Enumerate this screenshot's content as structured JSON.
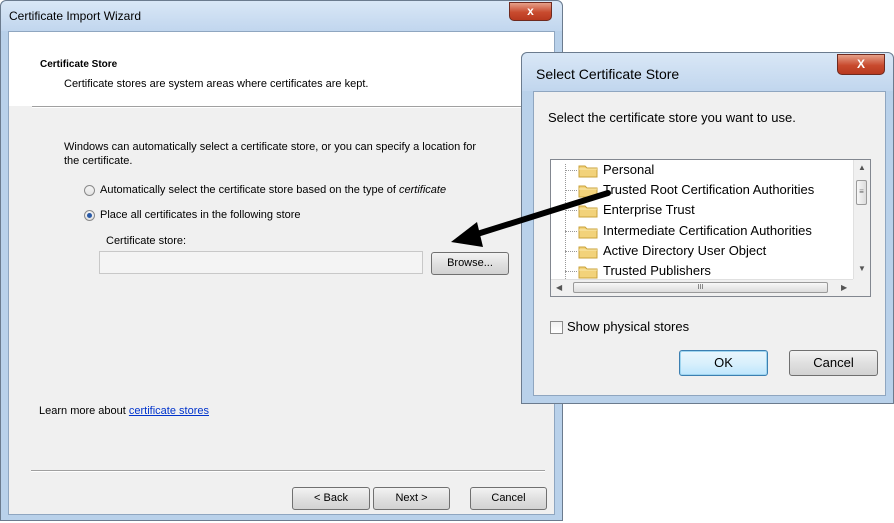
{
  "wizard": {
    "title": "Certificate Import Wizard",
    "close_glyph": "x",
    "header_title": "Certificate Store",
    "header_subtitle": "Certificate stores are system areas where certificates are kept.",
    "intro_line1": "Windows can automatically select a certificate store, or you can specify a location for",
    "intro_line2": "the certificate.",
    "radio_auto_label": "Automatically select the certificate store based on the type of",
    "radio_auto_label_italic": "certificate",
    "radio_auto_checked": false,
    "radio_place_label": "Place all certificates in the following store",
    "radio_place_checked": true,
    "store_label": "Certificate store:",
    "store_value": "",
    "browse_label": "Browse...",
    "learn_text": "Learn more about",
    "learn_link": "certificate stores",
    "back_label": "< Back",
    "next_label": "Next >",
    "cancel_label": "Cancel"
  },
  "dialog": {
    "title": "Select Certificate Store",
    "close_glyph": "X",
    "prompt": "Select the certificate store you want to use.",
    "stores": [
      "Personal",
      "Trusted Root Certification Authorities",
      "Enterprise Trust",
      "Intermediate Certification Authorities",
      "Active Directory User Object",
      "Trusted Publishers"
    ],
    "show_physical_label": "Show physical stores",
    "show_physical_checked": false,
    "ok_label": "OK",
    "cancel_label": "Cancel"
  },
  "icons": {
    "folder": "folder-icon",
    "arrow": "annotation-arrow"
  },
  "colors": {
    "title_bar": "#c1d6ee",
    "close_button": "#c84a2e",
    "link": "#0033cc",
    "folder": "#f2d27a"
  }
}
